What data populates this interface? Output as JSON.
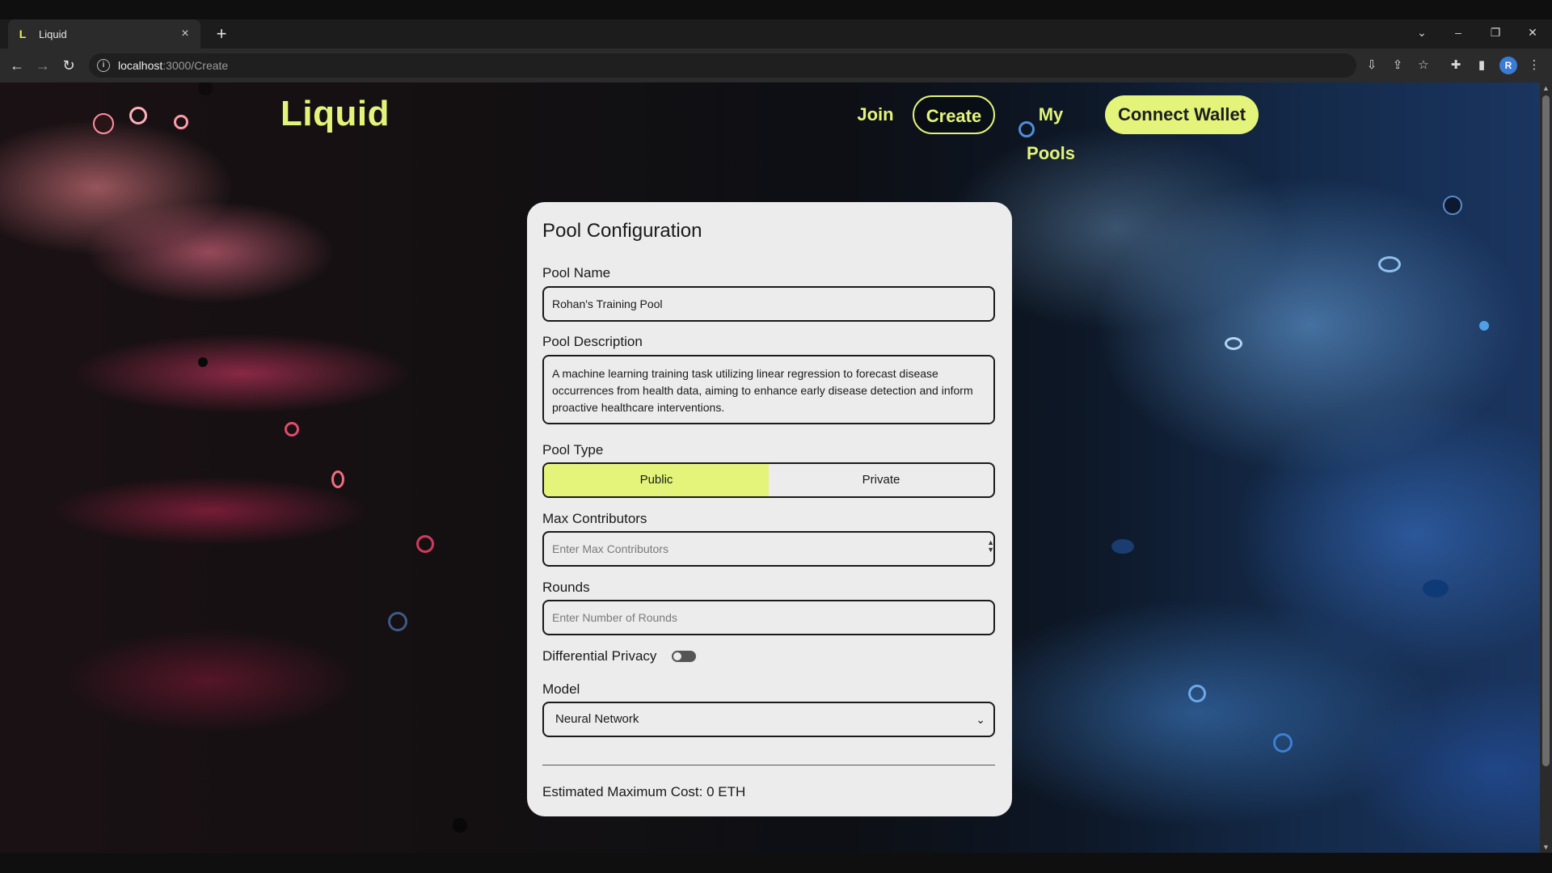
{
  "browser": {
    "tab_title": "Liquid",
    "tab_favicon": "L",
    "url_host": "localhost",
    "url_path": ":3000/Create",
    "avatar_initial": "R"
  },
  "site": {
    "logo": "Liquid",
    "nav": {
      "join": "Join",
      "create": "Create",
      "my_pools": "My Pools",
      "connect_wallet": "Connect Wallet"
    },
    "accent_color": "#e4f47a"
  },
  "form": {
    "title": "Pool Configuration",
    "pool_name": {
      "label": "Pool Name",
      "value": "Rohan's Training Pool"
    },
    "pool_description": {
      "label": "Pool Description",
      "value": "A machine learning training task utilizing linear regression to forecast disease occurrences from health data, aiming to enhance early disease detection and inform proactive healthcare interventions."
    },
    "pool_type": {
      "label": "Pool Type",
      "options": [
        "Public",
        "Private"
      ],
      "selected": "Public"
    },
    "max_contributors": {
      "label": "Max Contributors",
      "placeholder": "Enter Max Contributors"
    },
    "rounds": {
      "label": "Rounds",
      "placeholder": "Enter Number of Rounds"
    },
    "differential_privacy": {
      "label": "Differential Privacy",
      "enabled": false
    },
    "model": {
      "label": "Model",
      "selected": "Neural Network"
    },
    "estimated_cost": "Estimated Maximum Cost: 0 ETH"
  }
}
